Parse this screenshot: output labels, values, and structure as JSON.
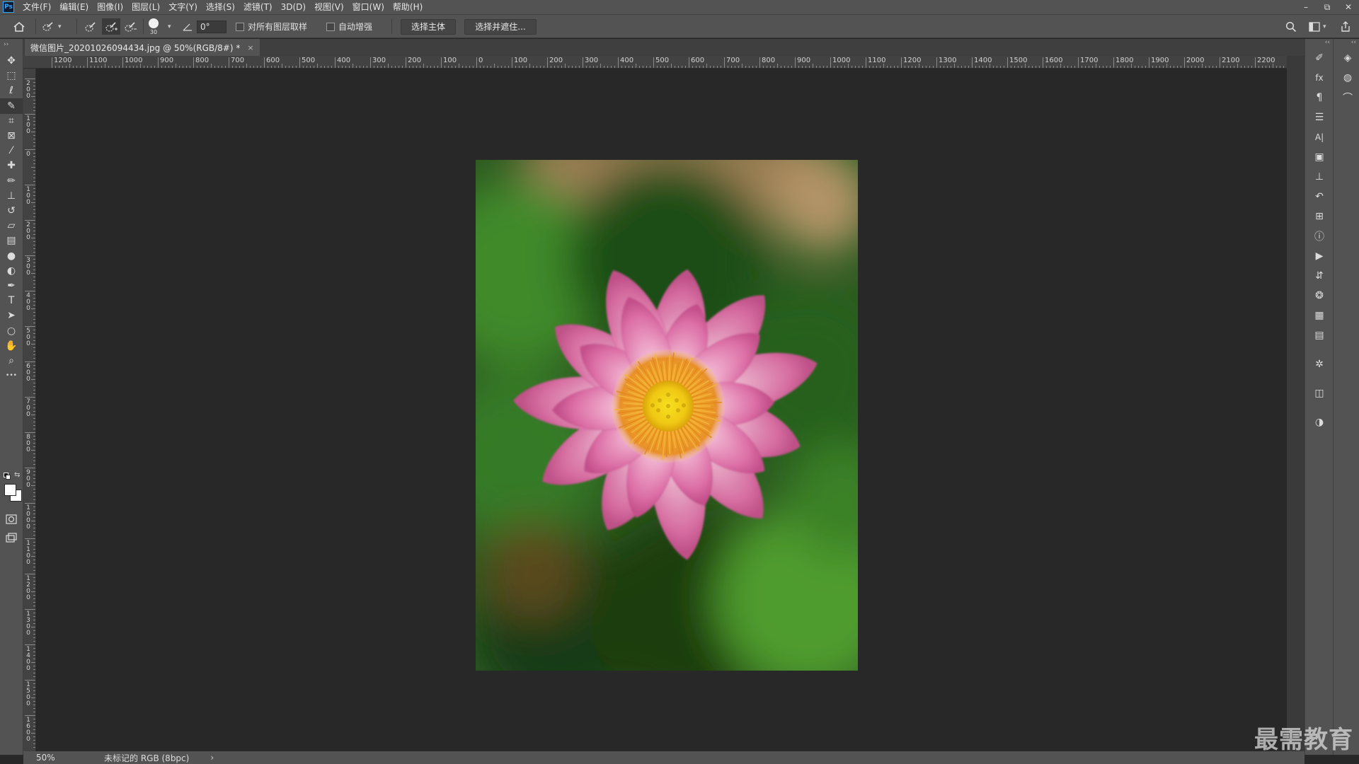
{
  "app": {
    "logo_text": "Ps"
  },
  "menu": [
    "文件(F)",
    "编辑(E)",
    "图像(I)",
    "图层(L)",
    "文字(Y)",
    "选择(S)",
    "滤镜(T)",
    "3D(D)",
    "视图(V)",
    "窗口(W)",
    "帮助(H)"
  ],
  "window_controls": {
    "minimize": "–",
    "restore": "⧉",
    "close": "✕"
  },
  "options": {
    "brush_size": "30",
    "angle_value": "0°",
    "sample_all_layers_label": "对所有图层取样",
    "auto_enhance_label": "自动增强",
    "select_subject_label": "选择主体",
    "select_mask_label": "选择并遮住..."
  },
  "document": {
    "tab_title": "微信图片_20201026094434.jpg @ 50%(RGB/8#) *",
    "close_glyph": "×"
  },
  "ruler": {
    "h_labels": [
      "1200",
      "1100",
      "1000",
      "900",
      "800",
      "700",
      "600",
      "500",
      "400",
      "300",
      "200",
      "100",
      "0",
      "100",
      "200",
      "300",
      "400",
      "500",
      "600",
      "700",
      "800",
      "900",
      "1000",
      "1100",
      "1200",
      "1300",
      "1400",
      "1500",
      "1600",
      "1700",
      "1800",
      "1900",
      "2000",
      "2100",
      "2200"
    ],
    "v_labels": [
      "2 0 0",
      "1 0 0",
      "0",
      "1 0 0",
      "2 0 0",
      "3 0 0",
      "4 0 0",
      "5 0 0",
      "6 0 0",
      "7 0 0",
      "8 0 0",
      "9 0 0",
      "1 0 0 0",
      "1 1 0 0",
      "1 2 0 0",
      "1 3 0 0",
      "1 4 0 0",
      "1 5 0 0",
      "1 6 0 0"
    ]
  },
  "tools": [
    {
      "name": "move-tool",
      "icon": "move-icon",
      "glyph": "✥"
    },
    {
      "name": "marquee-tool",
      "icon": "marquee-icon",
      "glyph": "⬚"
    },
    {
      "name": "lasso-tool",
      "icon": "lasso-icon",
      "glyph": "ℓ"
    },
    {
      "name": "quick-select-tool",
      "icon": "quick-select-icon",
      "glyph": "✎"
    },
    {
      "name": "crop-tool",
      "icon": "crop-icon",
      "glyph": "⌗"
    },
    {
      "name": "frame-tool",
      "icon": "frame-icon",
      "glyph": "⊠"
    },
    {
      "name": "eyedropper-tool",
      "icon": "eyedropper-icon",
      "glyph": "⁄"
    },
    {
      "name": "healing-tool",
      "icon": "bandage-icon",
      "glyph": "✚"
    },
    {
      "name": "brush-tool",
      "icon": "brush-icon",
      "glyph": "✏"
    },
    {
      "name": "stamp-tool",
      "icon": "stamp-icon",
      "glyph": "⊥"
    },
    {
      "name": "history-brush-tool",
      "icon": "history-brush-icon",
      "glyph": "↺"
    },
    {
      "name": "eraser-tool",
      "icon": "eraser-icon",
      "glyph": "▱"
    },
    {
      "name": "gradient-tool",
      "icon": "gradient-icon",
      "glyph": "▤"
    },
    {
      "name": "blur-tool",
      "icon": "blur-drop-icon",
      "glyph": "●"
    },
    {
      "name": "dodge-tool",
      "icon": "dodge-icon",
      "glyph": "◐"
    },
    {
      "name": "pen-tool",
      "icon": "pen-icon",
      "glyph": "✒"
    },
    {
      "name": "type-tool",
      "icon": "type-icon",
      "glyph": "T"
    },
    {
      "name": "path-select-tool",
      "icon": "path-select-icon",
      "glyph": "➤"
    },
    {
      "name": "ellipse-tool",
      "icon": "ellipse-icon",
      "glyph": "○"
    },
    {
      "name": "hand-tool",
      "icon": "hand-icon",
      "glyph": "✋"
    },
    {
      "name": "zoom-tool",
      "icon": "zoom-icon",
      "glyph": "⌕"
    },
    {
      "name": "more-tools",
      "icon": "ellipsis-icon",
      "glyph": "•••"
    }
  ],
  "right_panels": [
    {
      "name": "brush-settings-panel",
      "icon": "brush-settings-icon",
      "glyph": "✐"
    },
    {
      "name": "styles-panel",
      "icon": "fx-icon",
      "glyph": "fx"
    },
    {
      "name": "paragraph-panel",
      "icon": "paragraph-icon",
      "glyph": "¶"
    },
    {
      "name": "adjustments-panel",
      "icon": "sliders-icon",
      "glyph": "☰"
    },
    {
      "name": "character-panel",
      "icon": "character-icon",
      "glyph": "A|"
    },
    {
      "name": "libraries-panel",
      "icon": "library-icon",
      "glyph": "▣"
    },
    {
      "name": "clone-source-panel",
      "icon": "clone-source-icon",
      "glyph": "⊥"
    },
    {
      "name": "history-panel",
      "icon": "history-icon",
      "glyph": "↶"
    },
    {
      "name": "properties-panel",
      "icon": "properties-icon",
      "glyph": "⊞"
    },
    {
      "name": "info-panel",
      "icon": "info-icon",
      "glyph": "ⓘ"
    },
    {
      "name": "actions-panel",
      "icon": "play-icon",
      "glyph": "▶"
    },
    {
      "name": "glyphs-panel",
      "icon": "glyphs-icon",
      "glyph": "⇵"
    },
    {
      "name": "3d-panel",
      "icon": "3d-icon",
      "glyph": "❂"
    },
    {
      "name": "table-panel",
      "icon": "grid-icon",
      "glyph": "▦"
    },
    {
      "name": "notes-panel",
      "icon": "notes-icon",
      "glyph": "▤"
    },
    {
      "name": "navigator-panel",
      "icon": "navigator-icon",
      "glyph": "✲"
    },
    {
      "name": "export-panel",
      "icon": "export-icon",
      "glyph": "◫"
    },
    {
      "name": "color-panel",
      "icon": "color-wheel-icon",
      "glyph": "◑"
    }
  ],
  "right_panels2": [
    {
      "name": "layers-panel",
      "icon": "layers-icon",
      "glyph": "◈"
    },
    {
      "name": "channels-panel",
      "icon": "channels-icon",
      "glyph": "◍"
    },
    {
      "name": "paths-panel",
      "icon": "paths-icon",
      "glyph": "⌒"
    }
  ],
  "status": {
    "zoom": "50%",
    "doc_info": "未标记的 RGB (8bpc)",
    "arrow": "›"
  },
  "watermark": "最需教育"
}
